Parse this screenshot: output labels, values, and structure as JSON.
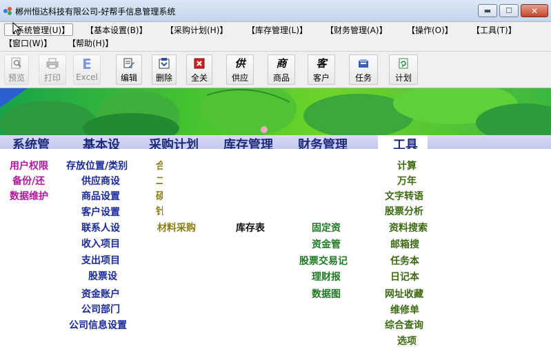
{
  "window": {
    "title": "郴州恒达科技有限公司-好帮手信息管理系统"
  },
  "menubar": {
    "items": [
      "【系统管理(U)】",
      "【基本设置(B)】",
      "【采购计划(H)】",
      "【库存管理(L)】",
      "【财务管理(A)】",
      "【操作(O)】",
      "【工具(T)】",
      "【窗口(W)】",
      "【帮助(H)】"
    ]
  },
  "toolbar": {
    "buttons": [
      {
        "label": "预览",
        "icon": "preview-icon",
        "enabled": false
      },
      {
        "label": "打印",
        "icon": "print-icon",
        "enabled": false
      },
      {
        "label": "Excel",
        "icon": "excel-icon",
        "enabled": false
      },
      {
        "label": "编辑",
        "icon": "edit-icon",
        "enabled": true
      },
      {
        "label": "删除",
        "icon": "delete-icon",
        "enabled": true
      },
      {
        "label": "全关",
        "icon": "close-all-icon",
        "enabled": true
      },
      {
        "label": "供应",
        "icon": "supply-icon",
        "enabled": true
      },
      {
        "label": "商品",
        "icon": "goods-icon",
        "enabled": true
      },
      {
        "label": "客户",
        "icon": "customer-icon",
        "enabled": true
      },
      {
        "label": "任务",
        "icon": "task-icon",
        "enabled": true
      },
      {
        "label": "计划",
        "icon": "plan-icon",
        "enabled": true
      }
    ]
  },
  "modules": {
    "tabs": [
      "系统管",
      "基本设",
      "采购计划",
      "库存管理",
      "财务管理",
      "工具"
    ]
  },
  "functions": {
    "system": [
      "用户权限",
      "备份/还",
      "数据维护"
    ],
    "basic": [
      "存放位置/类别",
      "供应商设",
      "商品设置",
      "客户设置",
      "联系人设",
      "收入项目",
      "支出项目",
      "股票设",
      "资金账户",
      "公司部门",
      "公司信息设置"
    ],
    "purchase_partial": [
      "合",
      "二",
      "硕",
      "针"
    ],
    "purchase": [
      "材料采购"
    ],
    "inventory": [
      "库存表"
    ],
    "finance": [
      "固定资",
      "资金管",
      "股票交易记",
      "理财报",
      "数据图"
    ],
    "tools": [
      "计算",
      "万年",
      "文字转语",
      "股票分析",
      "资料搜索",
      "邮箱搜",
      "任务本",
      "日记本",
      "网址收藏",
      "维修单",
      "综合查询",
      "选项"
    ]
  },
  "colors": {
    "system_functions": "#b5159e",
    "basic_functions": "#1a2a9a",
    "purchase_functions": "#8a7d10",
    "inventory_functions": "#111111",
    "finance_functions": "#1e7a22",
    "tools_functions": "#3d6a12",
    "module_bar": "#c8cdf0",
    "module_tab_text": "#1e2a7a"
  }
}
